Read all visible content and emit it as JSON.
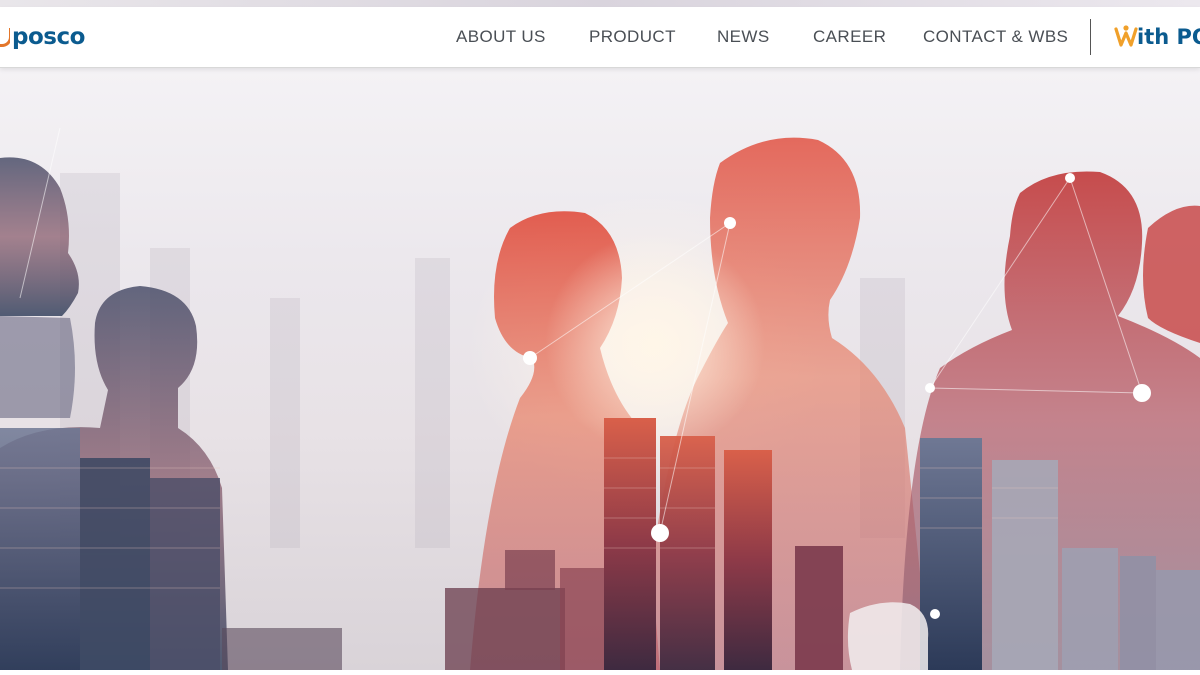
{
  "brand": {
    "logo_text": "posco",
    "accent_orange": "#e3762a",
    "brand_blue": "#0b5b8f"
  },
  "nav": {
    "items": [
      {
        "label": "ABOUT US"
      },
      {
        "label": "PRODUCT"
      },
      {
        "label": "NEWS"
      },
      {
        "label": "CAREER"
      },
      {
        "label": "CONTACT & WBS"
      }
    ]
  },
  "with_posco": {
    "text": "ith PO",
    "icon": "with-posco-w-icon"
  },
  "hero": {
    "image": "business-people-silhouettes-over-city-skyline"
  }
}
